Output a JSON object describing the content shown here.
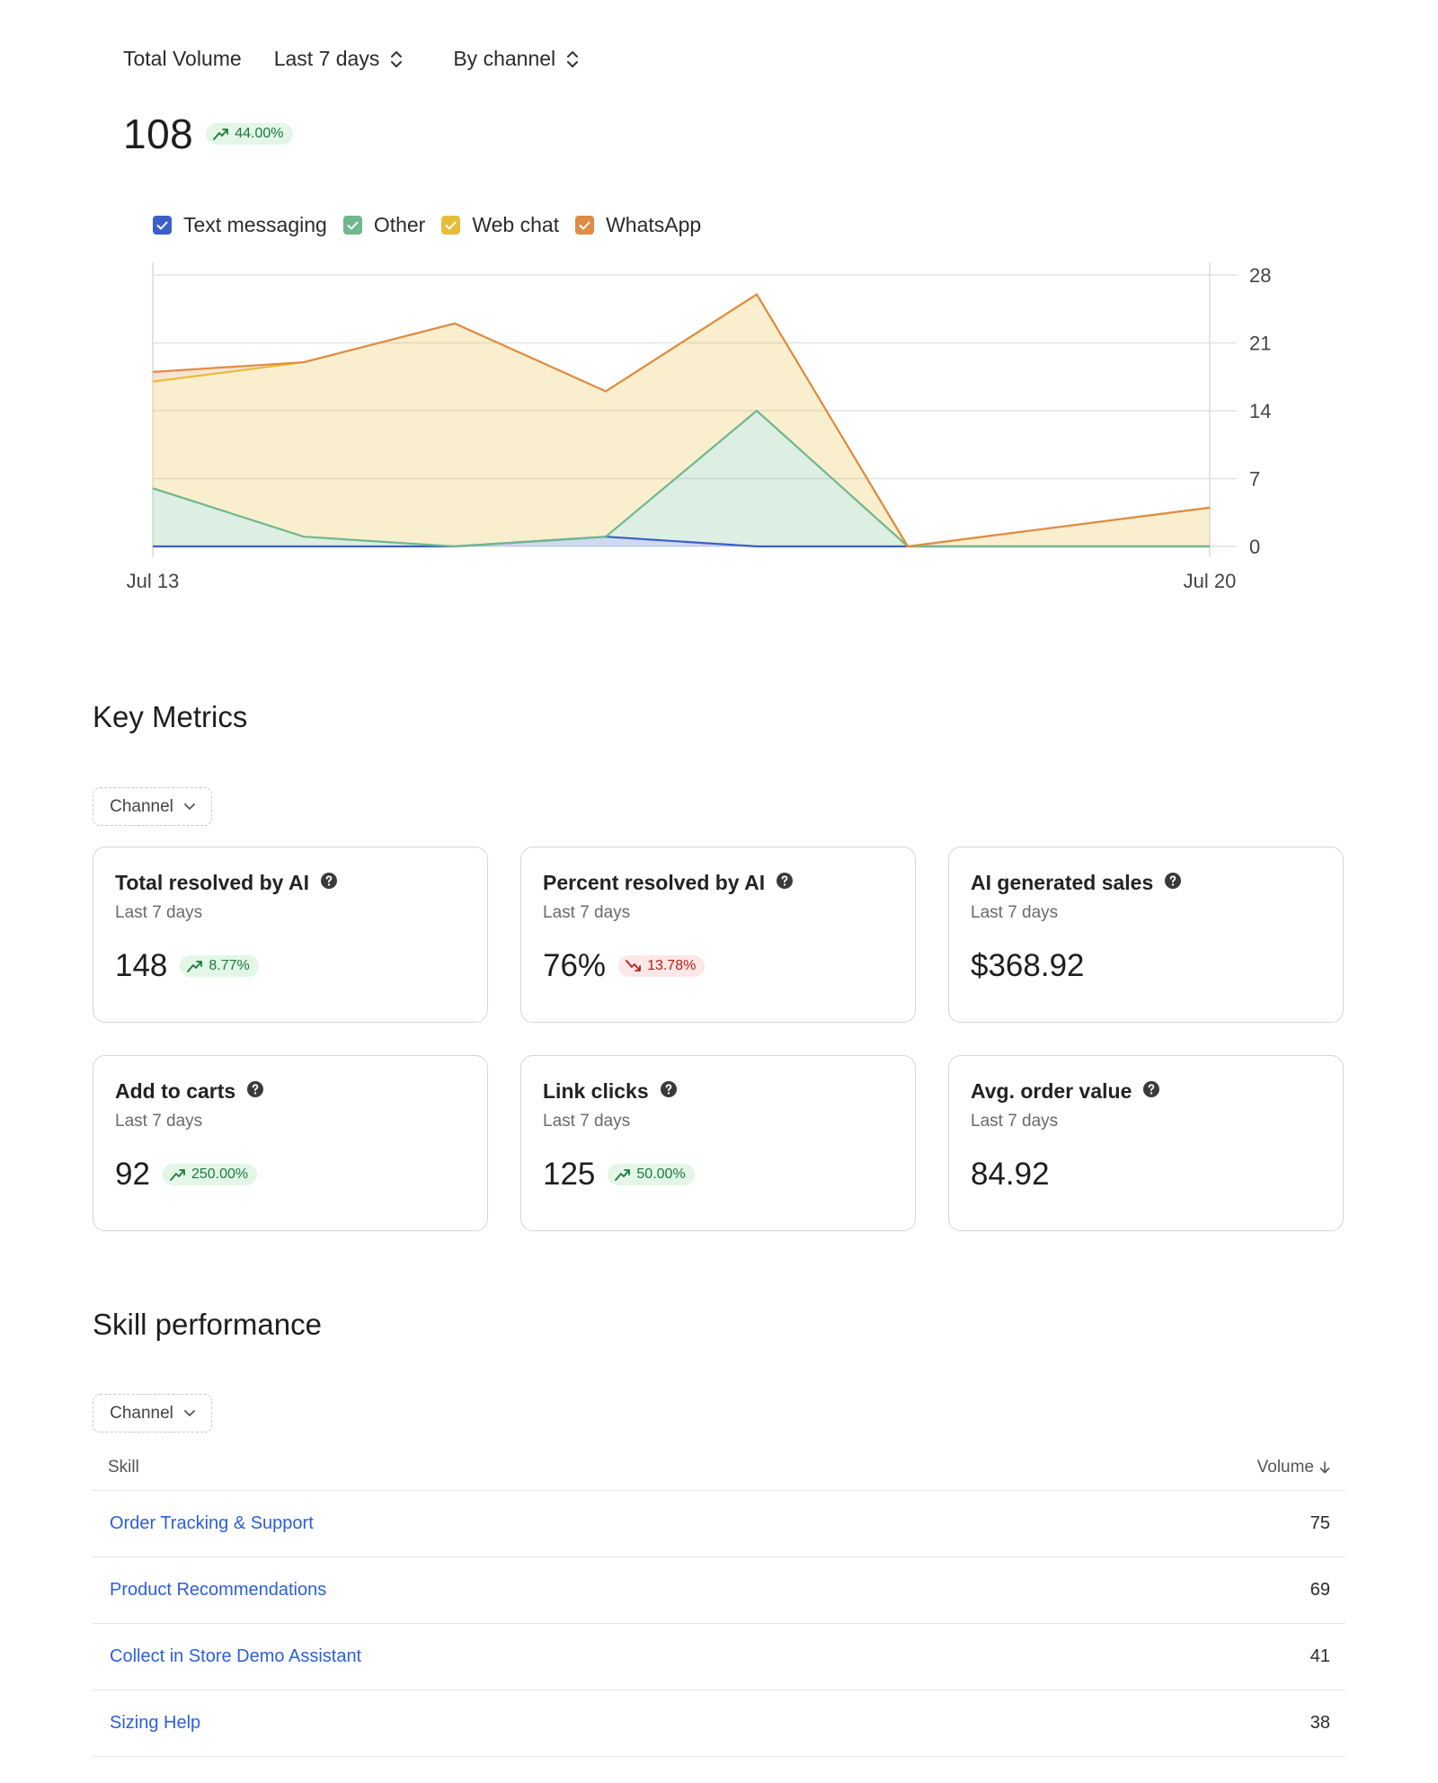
{
  "header": {
    "metric_label": "Total Volume",
    "period_selector": "Last 7 days",
    "group_selector": "By channel",
    "total": "108",
    "change": "44.00%"
  },
  "legend": [
    {
      "label": "Text messaging",
      "color": "#3b5fc9"
    },
    {
      "label": "Other",
      "color": "#6fb88c"
    },
    {
      "label": "Web chat",
      "color": "#e6bd38"
    },
    {
      "label": "WhatsApp",
      "color": "#e08c45"
    }
  ],
  "chart_data": {
    "type": "area",
    "x": [
      "Jul 13",
      "Jul 14",
      "Jul 15",
      "Jul 16",
      "Jul 17",
      "Jul 18",
      "Jul 19",
      "Jul 20"
    ],
    "x_tick_labels": [
      "Jul 13",
      "Jul 20"
    ],
    "y_tick_labels": [
      "0",
      "7",
      "14",
      "21",
      "28"
    ],
    "ylim": [
      0,
      28
    ],
    "grid": true,
    "y_axis_side": "right",
    "series": [
      {
        "name": "Text messaging",
        "color": "#3b5fc9",
        "values": [
          0,
          0,
          0,
          1,
          0,
          0,
          0,
          0
        ]
      },
      {
        "name": "Other",
        "color": "#6fb88c",
        "values": [
          6,
          1,
          0,
          0,
          14,
          0,
          0,
          0
        ]
      },
      {
        "name": "Web chat",
        "color": "#e6bd38",
        "values": [
          11,
          18,
          23,
          15,
          12,
          0,
          2,
          4
        ]
      },
      {
        "name": "WhatsApp",
        "color": "#e08c45",
        "values": [
          1,
          0,
          0,
          0,
          0,
          0,
          0,
          0
        ]
      }
    ]
  },
  "key_metrics": {
    "title": "Key Metrics",
    "filter_label": "Channel",
    "cards": [
      {
        "title": "Total resolved by AI",
        "subtitle": "Last 7 days",
        "value": "148",
        "change": "8.77%",
        "trend": "up"
      },
      {
        "title": "Percent resolved by AI",
        "subtitle": "Last 7 days",
        "value": "76%",
        "change": "13.78%",
        "trend": "down"
      },
      {
        "title": "AI generated sales",
        "subtitle": "Last 7 days",
        "value": "$368.92",
        "change": "",
        "trend": "none"
      },
      {
        "title": "Add to carts",
        "subtitle": "Last 7 days",
        "value": "92",
        "change": "250.00%",
        "trend": "up"
      },
      {
        "title": "Link clicks",
        "subtitle": "Last 7 days",
        "value": "125",
        "change": "50.00%",
        "trend": "up"
      },
      {
        "title": "Avg. order value",
        "subtitle": "Last 7 days",
        "value": "84.92",
        "change": "",
        "trend": "none"
      }
    ]
  },
  "skills": {
    "title": "Skill performance",
    "filter_label": "Channel",
    "columns": {
      "skill": "Skill",
      "volume": "Volume"
    },
    "rows": [
      {
        "skill": "Order Tracking & Support",
        "volume": "75"
      },
      {
        "skill": "Product Recommendations",
        "volume": "69"
      },
      {
        "skill": "Collect in Store Demo Assistant",
        "volume": "41"
      },
      {
        "skill": "Sizing Help",
        "volume": "38"
      }
    ]
  }
}
